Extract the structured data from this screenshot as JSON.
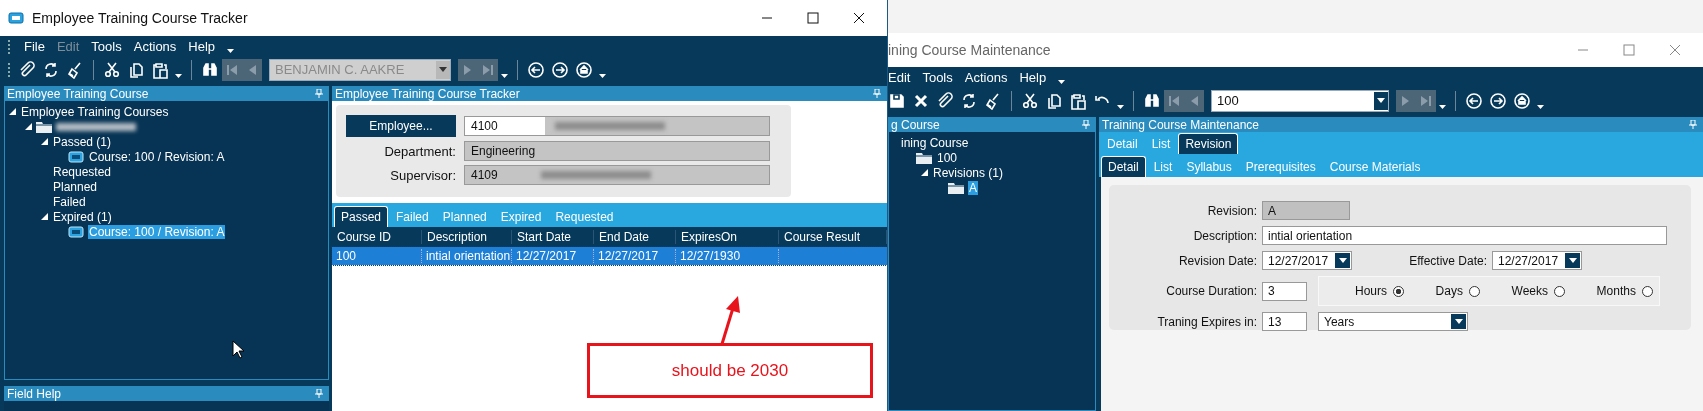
{
  "tracker_window": {
    "title": "Employee Training Course Tracker",
    "menu": [
      {
        "label": "File",
        "disabled": false
      },
      {
        "label": "Edit",
        "disabled": true
      },
      {
        "label": "Tools",
        "disabled": false
      },
      {
        "label": "Actions",
        "disabled": false
      },
      {
        "label": "Help",
        "disabled": false
      }
    ],
    "record_selector": {
      "value": "BENJAMIN C. AAKRE",
      "disabled": true
    },
    "left_panel": {
      "title": "Employee Training Course",
      "field_help_title": "Field Help",
      "tree": [
        {
          "label": "Employee Training Courses",
          "expanded": true,
          "selected": false,
          "children": [
            {
              "kind": "employee",
              "expanded": true,
              "selected": false,
              "children": [
                {
                  "label": "Passed (1)",
                  "expanded": true,
                  "selected": false,
                  "children": [
                    {
                      "label": "Course: 100 / Revision: A",
                      "kind": "course",
                      "selected": false
                    }
                  ]
                },
                {
                  "label": "Requested",
                  "selected": false
                },
                {
                  "label": "Planned",
                  "selected": false
                },
                {
                  "label": "Failed",
                  "selected": false
                },
                {
                  "label": "Expired (1)",
                  "expanded": true,
                  "selected": false,
                  "children": [
                    {
                      "label": "Course: 100 / Revision: A",
                      "kind": "course",
                      "selected": true
                    }
                  ]
                }
              ]
            }
          ]
        }
      ]
    },
    "tracker_panel": {
      "title": "Employee Training Course Tracker",
      "employee_button": "Employee...",
      "employee_id": "4100",
      "department_label": "Department:",
      "department": "Engineering",
      "supervisor_label": "Supervisor:",
      "supervisor_id": "4109",
      "tabs": [
        {
          "label": "Passed",
          "selected": true
        },
        {
          "label": "Failed",
          "selected": false
        },
        {
          "label": "Planned",
          "selected": false
        },
        {
          "label": "Expired",
          "selected": false
        },
        {
          "label": "Requested",
          "selected": false
        }
      ],
      "table": {
        "columns": [
          "Course ID",
          "Description",
          "Start Date",
          "End Date",
          "ExpiresOn",
          "Course Result"
        ],
        "rows": [
          {
            "cells": [
              "100",
              "intial orientation",
              "12/27/2017",
              "12/27/2017",
              "12/27/1930"
            ],
            "selected": true
          }
        ]
      }
    },
    "annotation": {
      "text": "should be 2030"
    }
  },
  "maintenance_window": {
    "title": "ining Course Maintenance",
    "menu": [
      {
        "label": "Edit",
        "disabled": false
      },
      {
        "label": "Tools",
        "disabled": false
      },
      {
        "label": "Actions",
        "disabled": false
      },
      {
        "label": "Help",
        "disabled": false
      }
    ],
    "record_selector": {
      "value": "100",
      "disabled": false
    },
    "left_panel": {
      "title": "g Course",
      "tree": [
        {
          "label": "ining Course",
          "selected": false,
          "children": [
            {
              "label": "100",
              "kind": "folder",
              "selected": false,
              "children": [
                {
                  "label": "Revisions (1)",
                  "expanded": true,
                  "selected": false,
                  "children": [
                    {
                      "label": "A",
                      "kind": "folder",
                      "selected": true
                    }
                  ]
                }
              ]
            }
          ]
        }
      ]
    },
    "main_panel": {
      "title": "Training Course Maintenance",
      "tabs": [
        {
          "label": "Detail",
          "selected": false
        },
        {
          "label": "List",
          "selected": false
        },
        {
          "label": "Revision",
          "selected": true
        }
      ],
      "subtabs": [
        {
          "label": "Detail",
          "selected": true
        },
        {
          "label": "List",
          "selected": false
        },
        {
          "label": "Syllabus",
          "selected": false
        },
        {
          "label": "Prerequisites",
          "selected": false
        },
        {
          "label": "Course Materials",
          "selected": false
        }
      ],
      "revision_label": "Revision:",
      "revision": "A",
      "description_label": "Description:",
      "description": "intial orientation",
      "revision_date_label": "Revision Date:",
      "revision_date": "12/27/2017",
      "effective_date_label": "Effective Date:",
      "effective_date": "12/27/2017",
      "duration_label": "Course Duration:",
      "duration": "3",
      "duration_units": [
        {
          "label": "Hours",
          "selected": true
        },
        {
          "label": "Days",
          "selected": false
        },
        {
          "label": "Weeks",
          "selected": false
        },
        {
          "label": "Months",
          "selected": false
        }
      ],
      "expires_label": "Traning Expires in:",
      "expires": "13",
      "expires_unit": "Years"
    }
  }
}
